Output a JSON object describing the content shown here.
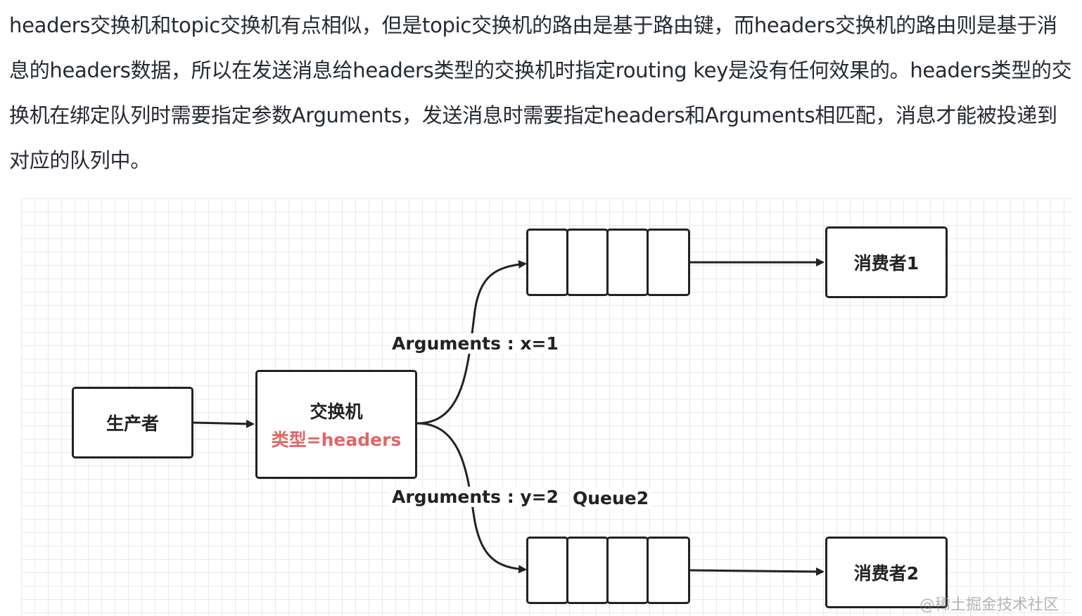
{
  "paragraph": "headers交换机和topic交换机有点相似，但是topic交换机的路由是基于路由键，而headers交换机的路由则是基于消息的headers数据，所以在发送消息给headers类型的交换机时指定routing key是没有任何效果的。headers类型的交换机在绑定队列时需要指定参数Arguments，发送消息时需要指定headers和Arguments相匹配，消息才能被投递到对应的队列中。",
  "diagram": {
    "producer": "生产者",
    "exchange": {
      "name": "交换机",
      "type": "类型=headers"
    },
    "arguments_top": "Arguments : x=1",
    "arguments_bottom": "Arguments : y=2",
    "queue2_label": "Queue2",
    "consumer1": "消费者1",
    "consumer2": "消费者2"
  },
  "watermark": "@稀土掘金技术社区",
  "colors": {
    "exchange_type": "#e06666",
    "border": "#222222",
    "grid": "#e9e9e9"
  }
}
